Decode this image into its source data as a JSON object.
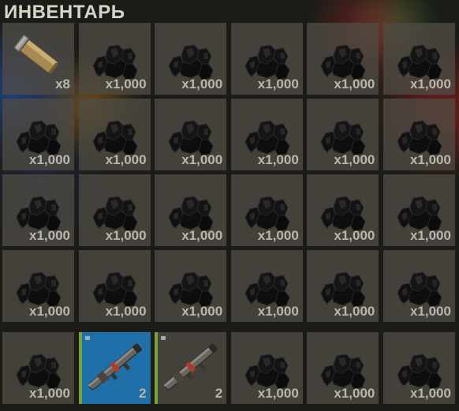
{
  "inventory": {
    "title": "ИНВЕНТАРЬ",
    "main_slots": [
      {
        "item": "ammo-casing-icon",
        "qty": "x8"
      },
      {
        "item": "black-debris-icon",
        "qty": "x1,000"
      },
      {
        "item": "black-debris-icon",
        "qty": "x1,000"
      },
      {
        "item": "black-debris-icon",
        "qty": "x1,000"
      },
      {
        "item": "black-debris-icon",
        "qty": "x1,000"
      },
      {
        "item": "black-debris-icon",
        "qty": "x1,000"
      },
      {
        "item": "black-debris-icon",
        "qty": "x1,000"
      },
      {
        "item": "black-debris-icon",
        "qty": "x1,000"
      },
      {
        "item": "black-debris-icon",
        "qty": "x1,000"
      },
      {
        "item": "black-debris-icon",
        "qty": "x1,000"
      },
      {
        "item": "black-debris-icon",
        "qty": "x1,000"
      },
      {
        "item": "black-debris-icon",
        "qty": "x1,000"
      },
      {
        "item": "black-debris-icon",
        "qty": "x1,000"
      },
      {
        "item": "black-debris-icon",
        "qty": "x1,000"
      },
      {
        "item": "black-debris-icon",
        "qty": "x1,000"
      },
      {
        "item": "black-debris-icon",
        "qty": "x1,000"
      },
      {
        "item": "black-debris-icon",
        "qty": "x1,000"
      },
      {
        "item": "black-debris-icon",
        "qty": "x1,000"
      },
      {
        "item": "black-debris-icon",
        "qty": "x1,000"
      },
      {
        "item": "black-debris-icon",
        "qty": "x1,000"
      },
      {
        "item": "black-debris-icon",
        "qty": "x1,000"
      },
      {
        "item": "black-debris-icon",
        "qty": "x1,000"
      },
      {
        "item": "black-debris-icon",
        "qty": "x1,000"
      },
      {
        "item": "black-debris-icon",
        "qty": "x1,000"
      }
    ],
    "belt_slots": [
      {
        "item": "black-debris-icon",
        "qty": "x1,000",
        "selected": false
      },
      {
        "item": "rocket-launcher-icon",
        "qty": "2",
        "selected": true,
        "color": "#1f6fa8"
      },
      {
        "item": "rocket-launcher-icon",
        "qty": "2",
        "selected": false
      },
      {
        "item": "black-debris-icon",
        "qty": "x1,000",
        "selected": false
      },
      {
        "item": "black-debris-icon",
        "qty": "x1,000",
        "selected": false
      },
      {
        "item": "black-debris-icon",
        "qty": "x1,000",
        "selected": false
      }
    ]
  }
}
